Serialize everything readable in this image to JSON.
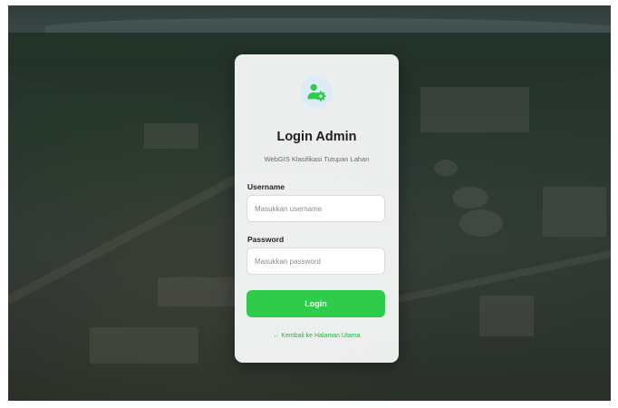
{
  "login": {
    "title": "Login Admin",
    "subtitle": "WebGIS Klasifikasi Tutupan Lahan",
    "username_label": "Username",
    "username_placeholder": "Masukkan username",
    "username_value": "",
    "password_label": "Password",
    "password_placeholder": "Masukkan password",
    "password_value": "",
    "login_button": "Login",
    "back_link": "← Kembali ke Halaman Utama"
  },
  "icons": {
    "logo": "user-gear-icon"
  },
  "colors": {
    "accent": "#2ecc4a",
    "logo_circle": "#dcecf7",
    "link": "#23b442",
    "card_background": "#f5f6f6"
  }
}
